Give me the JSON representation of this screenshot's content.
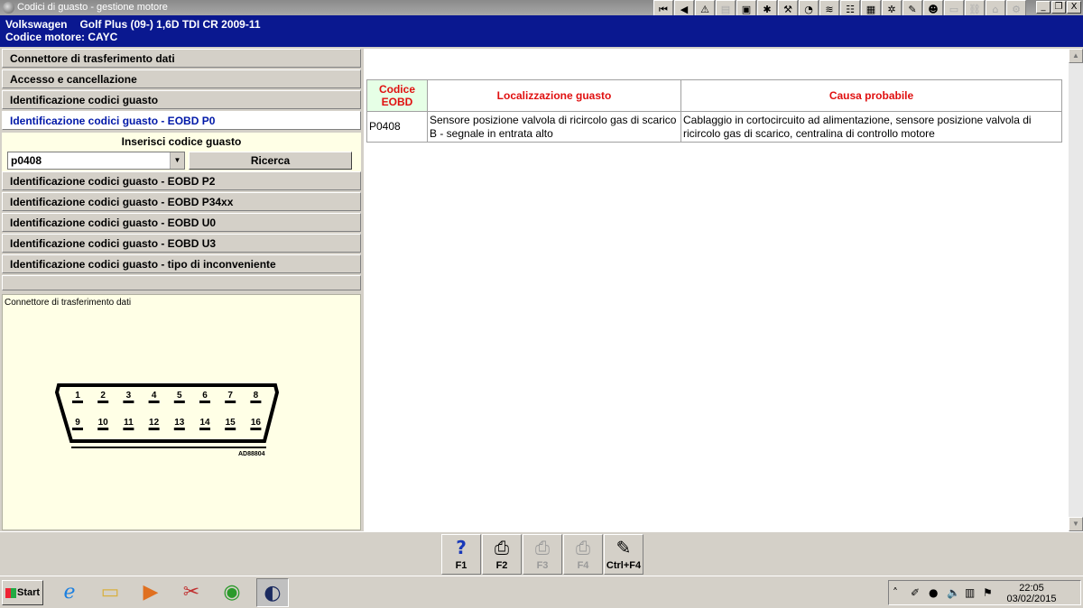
{
  "window": {
    "title": "Codici di guasto - gestione motore"
  },
  "toolbar": {
    "buttons": [
      {
        "name": "first-record-icon",
        "glyph": "⏮",
        "disabled": false
      },
      {
        "name": "previous-icon",
        "glyph": "◀",
        "disabled": false
      },
      {
        "name": "warning-icon",
        "glyph": "⚠",
        "disabled": false
      },
      {
        "name": "document-icon",
        "glyph": "▤",
        "disabled": true
      },
      {
        "name": "screen-icon",
        "glyph": "▣",
        "disabled": false
      },
      {
        "name": "engine-icon",
        "glyph": "✱",
        "disabled": false
      },
      {
        "name": "tool-icon",
        "glyph": "⚒",
        "disabled": false
      },
      {
        "name": "gauge-icon",
        "glyph": "◔",
        "disabled": false
      },
      {
        "name": "chart-icon",
        "glyph": "≋",
        "disabled": false
      },
      {
        "name": "diagram-icon",
        "glyph": "☷",
        "disabled": false
      },
      {
        "name": "module-icon",
        "glyph": "▦",
        "disabled": false
      },
      {
        "name": "tree-icon",
        "glyph": "✲",
        "disabled": false
      },
      {
        "name": "brush-icon",
        "glyph": "✎",
        "disabled": false
      },
      {
        "name": "person-icon",
        "glyph": "☻",
        "disabled": false
      },
      {
        "name": "blank-icon",
        "glyph": "▭",
        "disabled": true
      },
      {
        "name": "link-icon",
        "glyph": "⛓",
        "disabled": true
      },
      {
        "name": "car-icon",
        "glyph": "⌂",
        "disabled": true
      },
      {
        "name": "gear-icon",
        "glyph": "⚙",
        "disabled": true
      }
    ],
    "window_controls": [
      "_",
      "❐",
      "X"
    ]
  },
  "vehicle": {
    "make": "Volkswagen",
    "model": "Golf Plus (09-) 1,6D TDI CR 2009-11",
    "engine_code_line": "Codice motore: CAYC"
  },
  "menu_top": [
    {
      "label": "Connettore di trasferimento dati"
    },
    {
      "label": "Accesso e cancellazione"
    },
    {
      "label": "Identificazione codici guasto"
    }
  ],
  "menu_active": {
    "label": "Identificazione codici guasto - EOBD P0"
  },
  "search": {
    "label": "Inserisci codice guasto",
    "value": "p0408",
    "button": "Ricerca"
  },
  "menu_bottom": [
    {
      "label": "Identificazione codici guasto - EOBD P2"
    },
    {
      "label": "Identificazione codici guasto - EOBD P34xx"
    },
    {
      "label": "Identificazione codici guasto - EOBD U0"
    },
    {
      "label": "Identificazione codici guasto - EOBD U3"
    },
    {
      "label": "Identificazione codici guasto - tipo di inconveniente"
    }
  ],
  "diagram": {
    "title": "Connettore di trasferimento dati",
    "pins_top": [
      "1",
      "2",
      "3",
      "4",
      "5",
      "6",
      "7",
      "8"
    ],
    "pins_bottom": [
      "9",
      "10",
      "11",
      "12",
      "13",
      "14",
      "15",
      "16"
    ],
    "ref": "AD88804"
  },
  "table": {
    "headers": {
      "code_line1": "Codice",
      "code_line2": "EOBD",
      "location": "Localizzazione guasto",
      "cause": "Causa probabile"
    },
    "rows": [
      {
        "code": "P0408",
        "location": "Sensore posizione valvola di ricircolo gas di scarico B - segnale in entrata alto",
        "cause": "Cablaggio in cortocircuito ad alimentazione, sensore posizione valvola di ricircolo gas di scarico, centralina di controllo motore"
      }
    ]
  },
  "function_keys": [
    {
      "label": "F1",
      "icon": "question-icon",
      "glyph": "?",
      "disabled": false
    },
    {
      "label": "F2",
      "icon": "printer-icon",
      "glyph": "⎙",
      "disabled": false
    },
    {
      "label": "F3",
      "icon": "print-preview-icon",
      "glyph": "⎙",
      "disabled": true
    },
    {
      "label": "F4",
      "icon": "print-setup-icon",
      "glyph": "⎙",
      "disabled": true
    },
    {
      "label": "Ctrl+F4",
      "icon": "notes-icon",
      "glyph": "✎",
      "disabled": false
    }
  ],
  "taskbar": {
    "start": "Start",
    "apps": [
      {
        "name": "ie-icon",
        "glyph": "ℯ",
        "active": false
      },
      {
        "name": "explorer-icon",
        "glyph": "▭",
        "active": false
      },
      {
        "name": "media-player-icon",
        "glyph": "▶",
        "active": false
      },
      {
        "name": "scissors-icon",
        "glyph": "✂",
        "active": false
      },
      {
        "name": "chrome-icon",
        "glyph": "◉",
        "active": false
      },
      {
        "name": "autodata-icon",
        "glyph": "◐",
        "active": true
      }
    ],
    "tray": [
      "˄",
      "✐",
      "●",
      "🔈",
      "▥",
      "⚑"
    ],
    "time": "22:05",
    "date": "03/02/2015"
  },
  "colors": {
    "header_bg": "#0a1890",
    "active_menu_text": "#0018a8",
    "table_header_text": "#e01010",
    "panel_bg": "#ffffe6"
  }
}
